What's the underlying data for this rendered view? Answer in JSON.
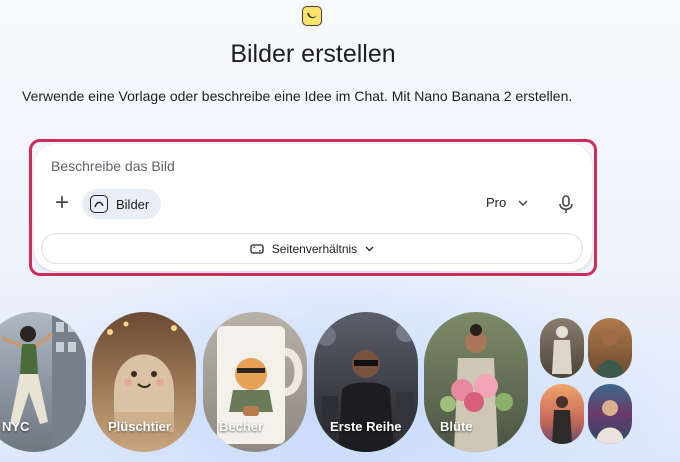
{
  "header": {
    "logo_icon": "banana-icon",
    "title": "Bilder erstellen",
    "subtitle": "Verwende eine Vorlage oder beschreibe eine Idee im Chat. Mit Nano Banana 2 erstellen."
  },
  "prompt": {
    "placeholder": "Beschreibe das Bild",
    "add_icon": "plus-icon",
    "tool_chip": {
      "icon": "image-icon",
      "label": "Bilder"
    },
    "model": {
      "label": "Pro",
      "icon": "chevron-down-icon"
    },
    "mic_icon": "microphone-icon",
    "aspect": {
      "icon": "aspect-ratio-icon",
      "label": "Seitenverhältnis",
      "chevron": "chevron-down-icon"
    }
  },
  "templates": [
    {
      "label": "NYC"
    },
    {
      "label": "Plüschtier"
    },
    {
      "label": "Becher"
    },
    {
      "label": "Erste Reihe"
    },
    {
      "label": "Blüte"
    }
  ],
  "colors": {
    "accent_outline": "#d12b5b",
    "chip_bg": "#e9eef6"
  }
}
